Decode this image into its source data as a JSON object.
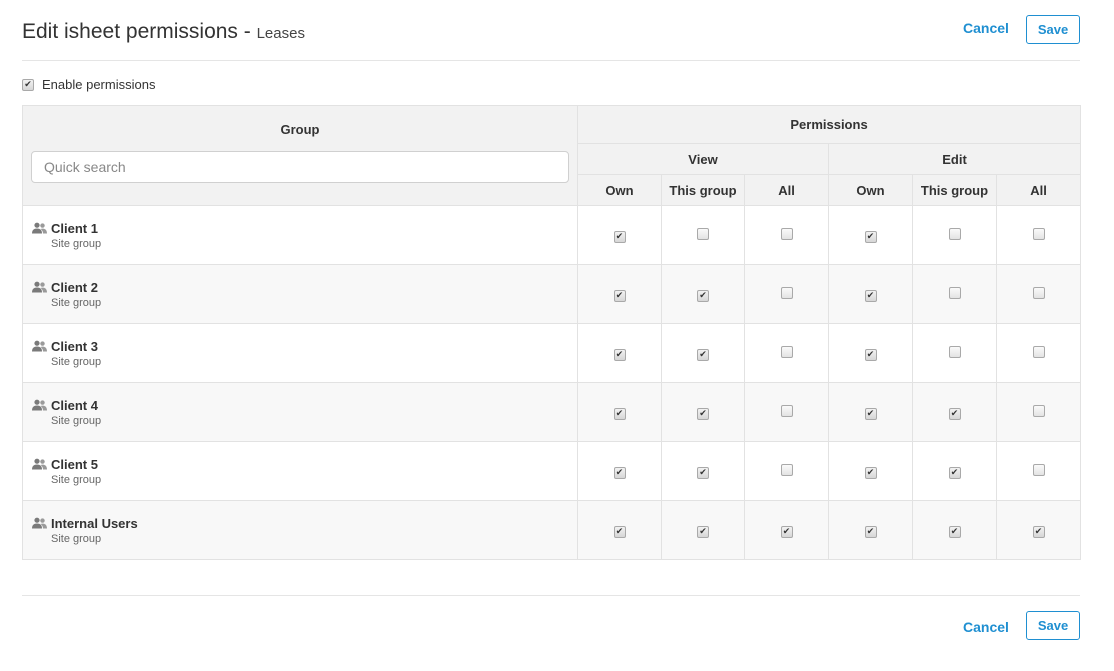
{
  "header": {
    "title": "Edit isheet permissions - ",
    "subtitle": "Leases",
    "cancel_label": "Cancel",
    "save_label": "Save"
  },
  "enable": {
    "label": "Enable permissions",
    "checked": true
  },
  "table": {
    "group_header": "Group",
    "permissions_header": "Permissions",
    "view_header": "View",
    "edit_header": "Edit",
    "cols": [
      "Own",
      "This group",
      "All",
      "Own",
      "This group",
      "All"
    ],
    "search_placeholder": "Quick search",
    "rows": [
      {
        "name": "Client 1",
        "type": "Site group",
        "perms": [
          true,
          false,
          false,
          true,
          false,
          false
        ]
      },
      {
        "name": "Client 2",
        "type": "Site group",
        "perms": [
          true,
          true,
          false,
          true,
          false,
          false
        ]
      },
      {
        "name": "Client 3",
        "type": "Site group",
        "perms": [
          true,
          true,
          false,
          true,
          false,
          false
        ]
      },
      {
        "name": "Client 4",
        "type": "Site group",
        "perms": [
          true,
          true,
          false,
          true,
          true,
          false
        ]
      },
      {
        "name": "Client 5",
        "type": "Site group",
        "perms": [
          true,
          true,
          false,
          true,
          true,
          false
        ]
      },
      {
        "name": "Internal Users",
        "type": "Site group",
        "perms": [
          true,
          true,
          true,
          true,
          true,
          true
        ]
      }
    ]
  },
  "footer": {
    "cancel_label": "Cancel",
    "save_label": "Save"
  },
  "icons": {
    "group": "users-icon",
    "check": "checkmark-icon"
  },
  "colors": {
    "accent": "#1f8fd1",
    "header_bg": "#f2f2f2",
    "border": "#e2e2e2"
  }
}
